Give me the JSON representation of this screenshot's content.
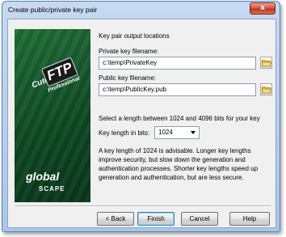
{
  "window": {
    "title": "Create public/private key pair",
    "close_glyph": "x"
  },
  "banner": {
    "product_prefix": "Cute",
    "product_name": "FTP",
    "product_edition": "Professional",
    "company_top": "global",
    "company_bottom": "SCAPE"
  },
  "section_title": "Key pair output locations",
  "private_key": {
    "label": "Private key filename:",
    "value": "c:\\temp\\PrivateKey",
    "browse_icon": "folder-icon"
  },
  "public_key": {
    "label": "Public key filename:",
    "value": "c:\\temp\\PublicKey.pub",
    "browse_icon": "folder-icon"
  },
  "key_length": {
    "instruction": "Select a length between 1024 and 4096 bits for your key",
    "label": "Key length in bits:",
    "selected": "1024"
  },
  "description": "A key length of 1024 is advisable. Longer key lengths improve security, but slow down the generation and authentication processes.  Shorter key lengths speed up generation and authentication, but are less secure.",
  "buttons": {
    "back": "< Back",
    "finish": "Finish",
    "cancel": "Cancel",
    "help": "Help"
  },
  "colors": {
    "banner_green": "#0f4a23",
    "window_frame": "#a9c6ea",
    "close_red": "#c2341a"
  }
}
